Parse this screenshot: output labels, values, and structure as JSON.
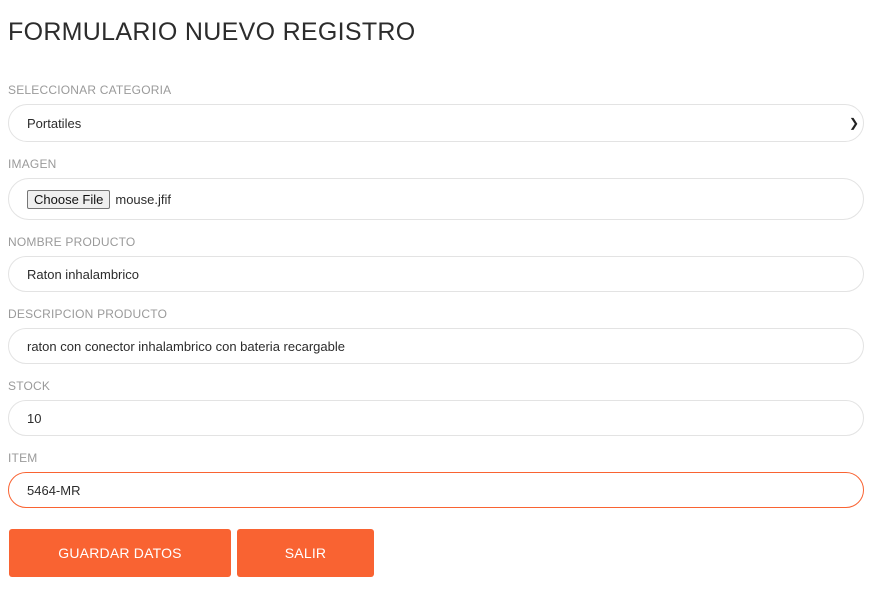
{
  "title": "FORMULARIO NUEVO REGISTRO",
  "accent_color": "#f96332",
  "fields": {
    "categoria": {
      "label": "SELECCIONAR CATEGORIA",
      "value": "Portatiles",
      "icon": "chevron-down-icon"
    },
    "imagen": {
      "label": "IMAGEN",
      "button": "Choose File",
      "value": "mouse.jfif"
    },
    "nombre": {
      "label": "NOMBRE PRODUCTO",
      "value": "Raton inhalambrico"
    },
    "descripcion": {
      "label": "DESCRIPCION PRODUCTO",
      "value": "raton con conector inhalambrico con bateria recargable"
    },
    "stock": {
      "label": "STOCK",
      "value": "10"
    },
    "item": {
      "label": "ITEM",
      "value": "5464-MR"
    }
  },
  "buttons": {
    "guardar": "GUARDAR DATOS",
    "salir": "SALIR"
  }
}
